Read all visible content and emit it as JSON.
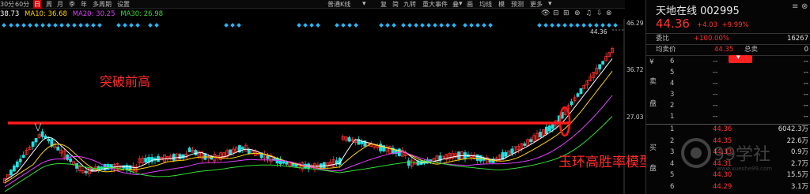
{
  "toolbar": {
    "items": [
      {
        "label": "30分",
        "active": false
      },
      {
        "label": "60分",
        "active": false
      },
      {
        "label": "日",
        "active": true
      },
      {
        "label": "周",
        "active": false
      },
      {
        "label": "月",
        "active": false
      },
      {
        "label": "季",
        "active": false
      },
      {
        "label": "年",
        "active": false
      },
      {
        "label": "多周期",
        "active": false
      },
      {
        "label": "设置",
        "active": false
      }
    ],
    "view_mode": "普通K线",
    "tools": [
      "复",
      "简",
      "九转",
      "重大事件",
      "叠",
      "画",
      "均线",
      "模",
      "预测",
      "更多"
    ]
  },
  "ma_legend": [
    {
      "label": "38.73",
      "color": "#ffffff"
    },
    {
      "label": "MA10: 36.68",
      "color": "#ffd400"
    },
    {
      "label": "MA20: 30.25",
      "color": "#e040fb"
    },
    {
      "label": "MA30: 26.98",
      "color": "#33dd33"
    }
  ],
  "axis": {
    "ticks": [
      "46.29",
      "36.72",
      "27.03"
    ],
    "last_price_tag": "44.36"
  },
  "annotations": {
    "breakout": "突破前高",
    "model": "玉环高胜率模型"
  },
  "quote": {
    "title": "天地在线 002995",
    "price": "44.36",
    "change": "+4.03",
    "change_pct": "+9.99%",
    "ratio_label": "委比",
    "ratio_value": "+100.00%",
    "ratio_volume": "16267",
    "avg_label": "均卖价",
    "avg_value": "44.35",
    "avg_mid": "总卖",
    "avg_right": "0"
  },
  "orderbook": {
    "sell_label": "卖盘",
    "buy_label": "买盘",
    "sell": [
      {
        "level": "6",
        "price": "--",
        "vol": "--"
      },
      {
        "level": "5",
        "price": "--",
        "vol": "--"
      },
      {
        "level": "4",
        "price": "--",
        "vol": "--"
      },
      {
        "level": "3",
        "price": "--",
        "vol": "--"
      },
      {
        "level": "2",
        "price": "--",
        "vol": "--"
      },
      {
        "level": "1",
        "price": "--",
        "vol": "--"
      }
    ],
    "buy": [
      {
        "level": "1",
        "price": "44.36",
        "vol": "6042.3万"
      },
      {
        "level": "2",
        "price": "44.35",
        "vol": "22.6万"
      },
      {
        "level": "3",
        "price": "44.33",
        "vol": "0.9万"
      },
      {
        "level": "4",
        "price": "44.31",
        "vol": "2.7万"
      },
      {
        "level": "5",
        "price": "44.30",
        "vol": "15.5万"
      },
      {
        "level": "6",
        "price": "44.29",
        "vol": "3.1万"
      }
    ]
  },
  "watermark": {
    "text": "99学社",
    "url": "www.xueshe99.com"
  },
  "colors": {
    "up": "#ff3030",
    "down": "#20e0e0",
    "accent_line": "#ff1a1a"
  }
}
